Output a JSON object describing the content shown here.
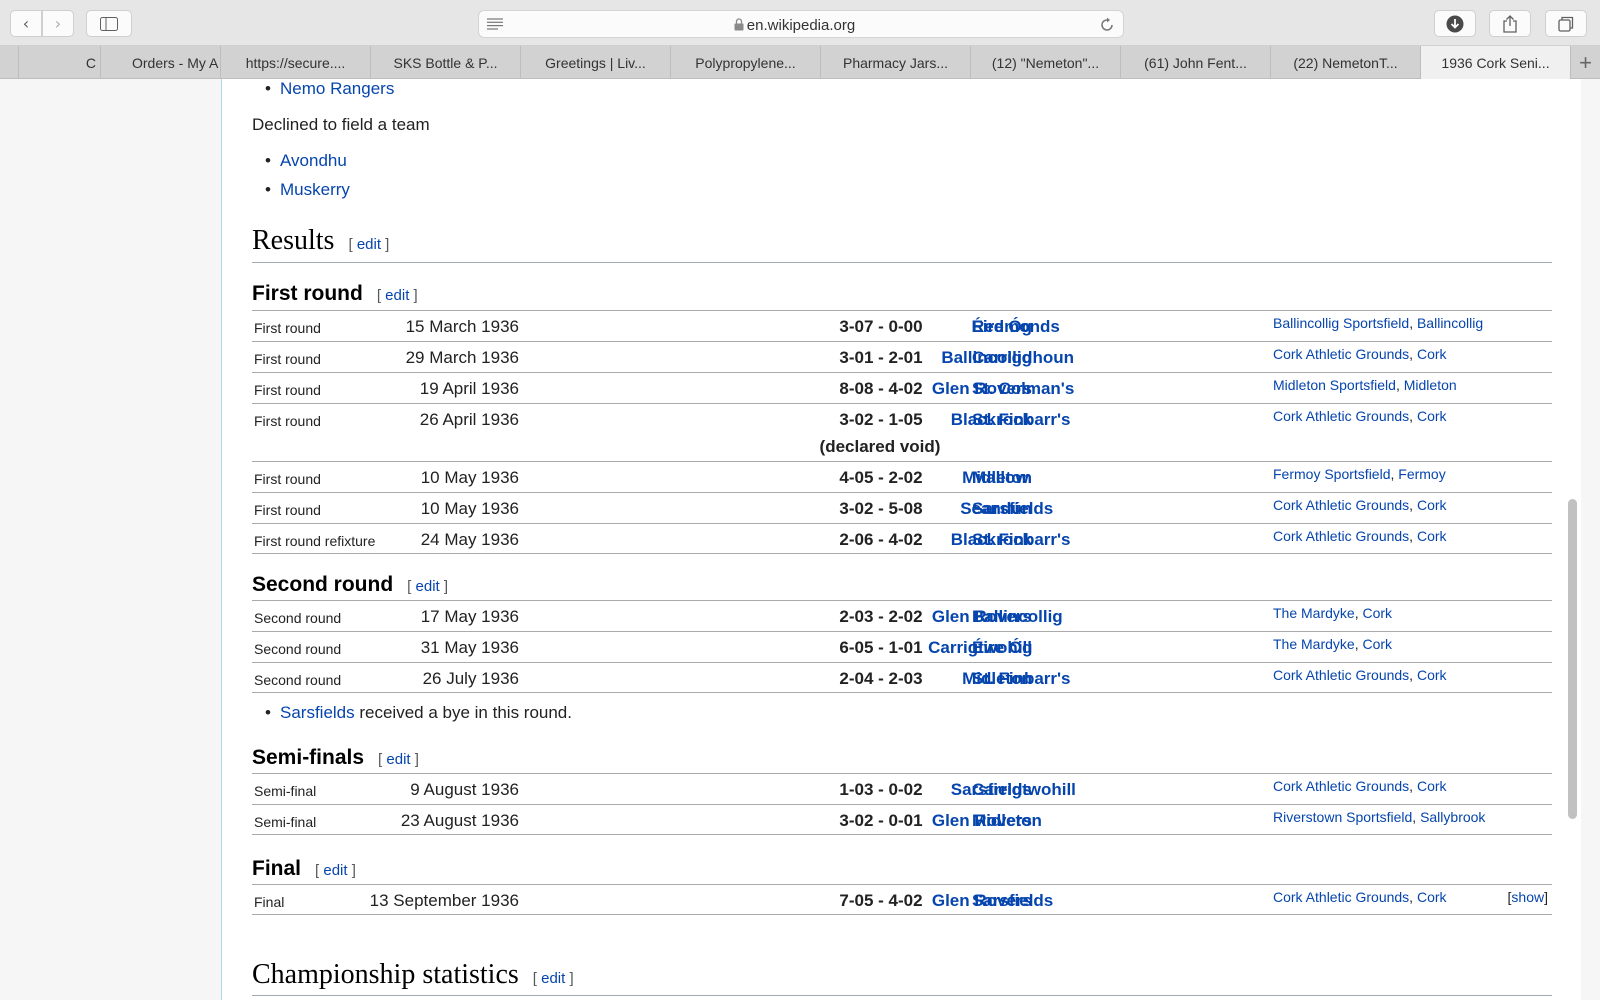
{
  "browser": {
    "url": "en.wikipedia.org",
    "tabs": [
      {
        "label": "C"
      },
      {
        "label": "Orders - My A"
      },
      {
        "label": "https://secure...."
      },
      {
        "label": "SKS Bottle & P..."
      },
      {
        "label": "Greetings | Liv..."
      },
      {
        "label": "Polypropylene..."
      },
      {
        "label": "Pharmacy Jars..."
      },
      {
        "label": "(12) \"Nemeton\"..."
      },
      {
        "label": "(61) John Fent..."
      },
      {
        "label": "(22) NemetonT..."
      },
      {
        "label": "1936 Cork Seni..."
      }
    ]
  },
  "article": {
    "top_list": [
      "Nemo Rangers"
    ],
    "declined_label": "Declined to field a team",
    "declined_list": [
      "Avondhu",
      "Muskerry"
    ],
    "results_heading": "Results",
    "edit_label": "edit",
    "bracket_open": "[",
    "bracket_close": "]",
    "venue_sep": ", ",
    "stats_heading": "Championship statistics",
    "bye_team": "Sarsfields",
    "bye_text": " received a bye in this round.",
    "show_label": "show",
    "sections": [
      {
        "title": "First round",
        "rows": [
          {
            "round": "First round",
            "date": "15 March 1936",
            "home": "Éire Óg",
            "score": "3-07 - 0-00",
            "away": "Redmonds",
            "venue": "Ballincollig Sportsfield",
            "place": "Ballincollig"
          },
          {
            "round": "First round",
            "date": "29 March 1936",
            "home": "Ballincollig",
            "score": "3-01 - 2-01",
            "away": "Carrigdhoun",
            "venue": "Cork Athletic Grounds",
            "place": "Cork"
          },
          {
            "round": "First round",
            "date": "19 April 1936",
            "home": "Glen Rovers",
            "score": "8-08 - 4-02",
            "away": "St. Colman's",
            "venue": "Midleton Sportsfield",
            "place": "Midleton"
          },
          {
            "round": "First round",
            "date": "26 April 1936",
            "home": "Blackrock",
            "score": "3-02 - 1-05",
            "away": "St. Finbarr's",
            "venue": "Cork Athletic Grounds",
            "place": "Cork",
            "note": "(declared void)"
          },
          {
            "round": "First round",
            "date": "10 May 1936",
            "home": "Midleton",
            "score": "4-05 - 2-02",
            "away": "Mallow",
            "venue": "Fermoy Sportsfield",
            "place": "Fermoy"
          },
          {
            "round": "First round",
            "date": "10 May 1936",
            "home": "Seandún",
            "score": "3-02 - 5-08",
            "away": "Sarsfields",
            "venue": "Cork Athletic Grounds",
            "place": "Cork"
          },
          {
            "round": "First round refixture",
            "date": "24 May 1936",
            "home": "Blackrock",
            "score": "2-06 - 4-02",
            "away": "St. Finbarr's",
            "venue": "Cork Athletic Grounds",
            "place": "Cork"
          }
        ]
      },
      {
        "title": "Second round",
        "rows": [
          {
            "round": "Second round",
            "date": "17 May 1936",
            "home": "Glen Rovers",
            "score": "2-03 - 2-02",
            "away": "Ballincollig",
            "venue": "The Mardyke",
            "place": "Cork"
          },
          {
            "round": "Second round",
            "date": "31 May 1936",
            "home": "Carrigtwohill",
            "score": "6-05 - 1-01",
            "away": "Éire Óg",
            "venue": "The Mardyke",
            "place": "Cork"
          },
          {
            "round": "Second round",
            "date": "26 July 1936",
            "home": "Midleton",
            "score": "2-04 - 2-03",
            "away": "St. Finbarr's",
            "venue": "Cork Athletic Grounds",
            "place": "Cork"
          }
        ]
      },
      {
        "title": "Semi-finals",
        "rows": [
          {
            "round": "Semi-final",
            "date": "9 August 1936",
            "home": "Sarsfields",
            "score": "1-03 - 0-02",
            "away": "Carrigtwohill",
            "venue": "Cork Athletic Grounds",
            "place": "Cork"
          },
          {
            "round": "Semi-final",
            "date": "23 August 1936",
            "home": "Glen Rovers",
            "score": "3-02 - 0-01",
            "away": "Midleton",
            "venue": "Riverstown Sportsfield",
            "place": "Sallybrook"
          }
        ]
      },
      {
        "title": "Final",
        "rows": [
          {
            "round": "Final",
            "date": "13 September 1936",
            "home": "Glen Rovers",
            "score": "7-05 - 4-02",
            "away": "Sarsfields",
            "venue": "Cork Athletic Grounds",
            "place": "Cork"
          }
        ]
      }
    ]
  }
}
